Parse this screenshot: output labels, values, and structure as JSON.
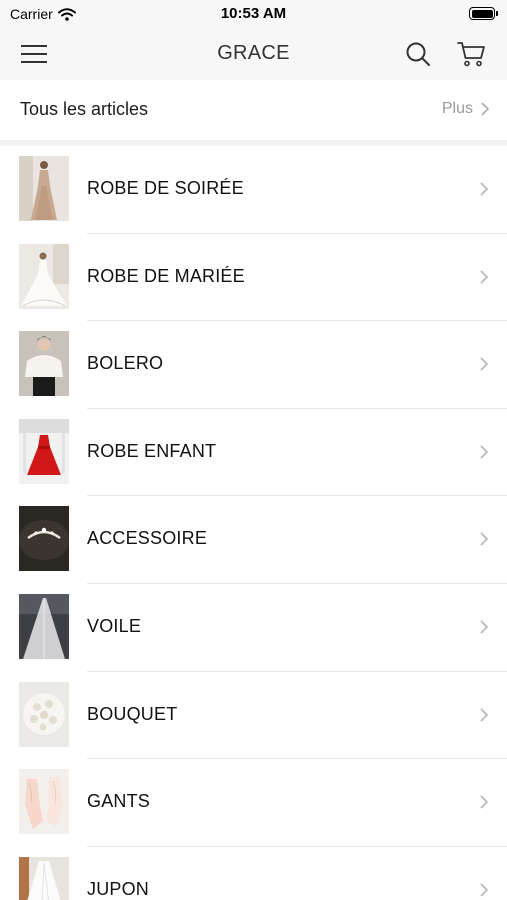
{
  "status_bar": {
    "carrier": "Carrier",
    "time": "10:53 AM",
    "battery_level": 1.0
  },
  "nav": {
    "title": "GRACE",
    "menu_icon": "hamburger-icon",
    "search_icon": "search-icon",
    "cart_icon": "cart-icon"
  },
  "section": {
    "title": "Tous les articles",
    "more_label": "Plus"
  },
  "categories": [
    {
      "label": "ROBE DE SOIRÉE",
      "thumb": "evening-gown-photo"
    },
    {
      "label": "ROBE DE MARIÉE",
      "thumb": "wedding-gown-photo"
    },
    {
      "label": "BOLERO",
      "thumb": "bolero-photo"
    },
    {
      "label": "ROBE ENFANT",
      "thumb": "child-dress-photo"
    },
    {
      "label": "ACCESSOIRE",
      "thumb": "tiara-photo"
    },
    {
      "label": "VOILE",
      "thumb": "veil-photo"
    },
    {
      "label": "BOUQUET",
      "thumb": "bouquet-photo"
    },
    {
      "label": "GANTS",
      "thumb": "gloves-photo"
    },
    {
      "label": "JUPON",
      "thumb": "petticoat-photo"
    }
  ],
  "colors": {
    "bar_bg": "#f7f7f7",
    "text": "#111111",
    "muted": "#9a9a9a",
    "separator": "#e6e6e6",
    "child_dress_red": "#d01818"
  }
}
